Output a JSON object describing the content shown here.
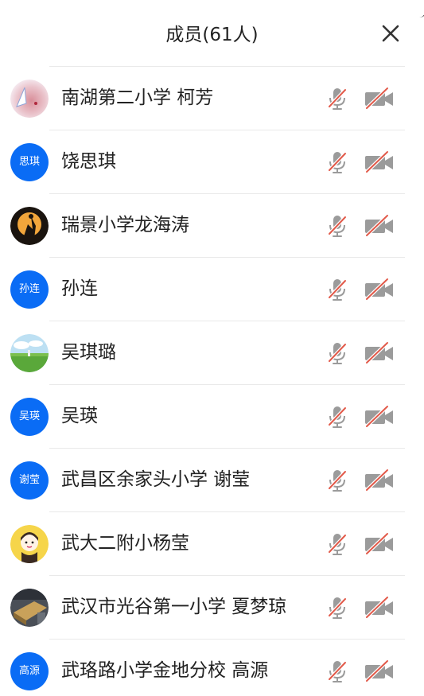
{
  "header": {
    "title": "成员(61人)"
  },
  "colors": {
    "avatar_blue": "#0a6cf5",
    "icon_gray": "#9b9b9b",
    "muted_slash": "#e25a4a"
  },
  "members": [
    {
      "name": "南湖第二小学 柯芳",
      "avatar_text": "",
      "avatar_kind": "photo-pink",
      "mic": "muted",
      "camera": "off"
    },
    {
      "name": "饶思琪",
      "avatar_text": "思琪",
      "avatar_kind": "text",
      "mic": "muted",
      "camera": "off"
    },
    {
      "name": "瑞景小学龙海涛",
      "avatar_text": "",
      "avatar_kind": "photo-dark",
      "mic": "muted",
      "camera": "off"
    },
    {
      "name": "孙连",
      "avatar_text": "孙连",
      "avatar_kind": "text",
      "mic": "muted",
      "camera": "off"
    },
    {
      "name": "吴琪璐",
      "avatar_text": "",
      "avatar_kind": "photo-field",
      "mic": "muted",
      "camera": "off"
    },
    {
      "name": "吴瑛",
      "avatar_text": "吴瑛",
      "avatar_kind": "text",
      "mic": "muted",
      "camera": "off"
    },
    {
      "name": "武昌区余家头小学 谢莹",
      "avatar_text": "谢莹",
      "avatar_kind": "text",
      "mic": "muted",
      "camera": "off"
    },
    {
      "name": "武大二附小杨莹",
      "avatar_text": "",
      "avatar_kind": "photo-cartoon",
      "mic": "muted",
      "camera": "off"
    },
    {
      "name": "武汉市光谷第一小学 夏梦琼",
      "avatar_text": "",
      "avatar_kind": "photo-room",
      "mic": "muted",
      "camera": "off"
    },
    {
      "name": "武珞路小学金地分校 高源",
      "avatar_text": "高源",
      "avatar_kind": "text",
      "mic": "muted",
      "camera": "off"
    }
  ]
}
